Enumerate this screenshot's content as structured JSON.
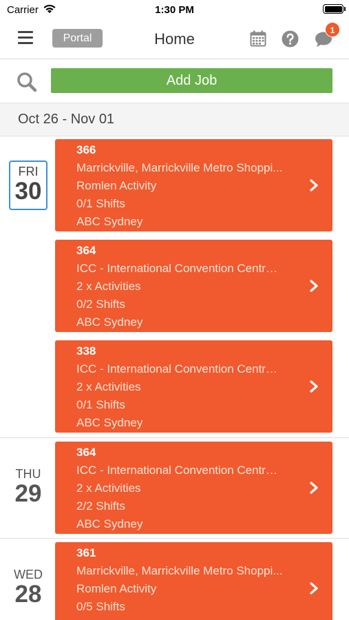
{
  "status_bar": {
    "carrier": "Carrier",
    "time": "1:30 PM"
  },
  "nav": {
    "portal_label": "Portal",
    "title": "Home",
    "notification_count": "1"
  },
  "actions": {
    "add_job_label": "Add Job"
  },
  "week": {
    "range": "Oct 26 - Nov 01"
  },
  "days": [
    {
      "name": "FRI",
      "num": "30",
      "selected": true,
      "jobs": [
        {
          "number": "366",
          "location": "Marrickville, Marrickville Metro Shoppi...",
          "activity": "Romlen Activity",
          "shifts": "0/1 Shifts",
          "client": "ABC Sydney"
        },
        {
          "number": "364",
          "location": "ICC - International Convention Centre,...",
          "activity": "2 x Activities",
          "shifts": "0/2 Shifts",
          "client": "ABC Sydney"
        },
        {
          "number": "338",
          "location": "ICC - International Convention Centre,...",
          "activity": "2 x Activities",
          "shifts": "0/1 Shifts",
          "client": "ABC Sydney"
        }
      ]
    },
    {
      "name": "THU",
      "num": "29",
      "selected": false,
      "jobs": [
        {
          "number": "364",
          "location": "ICC - International Convention Centre,...",
          "activity": "2 x Activities",
          "shifts": "2/2 Shifts",
          "client": "ABC Sydney"
        }
      ]
    },
    {
      "name": "WED",
      "num": "28",
      "selected": false,
      "jobs": [
        {
          "number": "361",
          "location": "Marrickville, Marrickville Metro Shoppi...",
          "activity": "Romlen Activity",
          "shifts": "0/5 Shifts",
          "client": ""
        }
      ]
    }
  ],
  "colors": {
    "card": "#f05a2e",
    "add_button": "#6ab04c",
    "selected_border": "#3d8fd6",
    "badge": "#f05a28"
  }
}
